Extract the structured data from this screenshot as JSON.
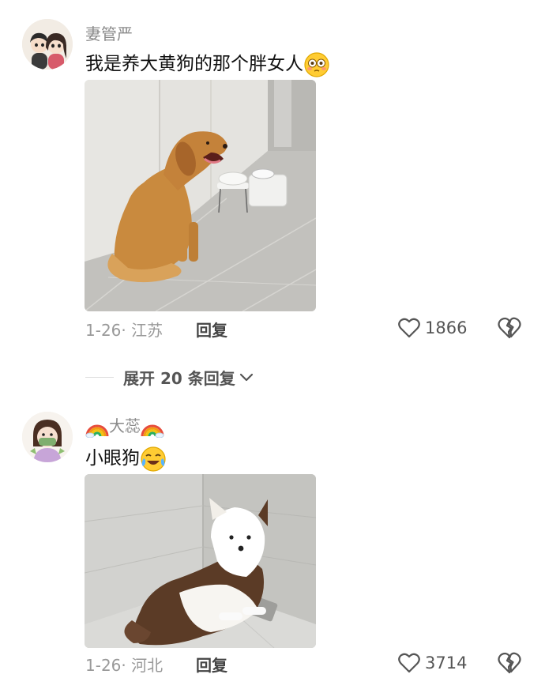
{
  "comments": [
    {
      "username": "妻管严",
      "text": "我是养大黄狗的那个胖女人",
      "text_emoji": "flushed-face-emoji",
      "photo_alt": "golden retriever sitting in kitchen",
      "date": "1-26· 江苏",
      "reply": "回复",
      "likes": "1866"
    },
    {
      "username": "大蕊",
      "username_emoji": "rainbow-emoji",
      "text": "小眼狗",
      "text_emoji": "crying-laughing-face-emoji",
      "photo_alt": "white and brown dog lying in bathroom corner",
      "date": "1-26· 河北",
      "reply": "回复",
      "likes": "3714"
    }
  ],
  "expand_replies": "展开 20 条回复",
  "colors": {
    "meta": "#999999",
    "username": "#8a8a8a",
    "text": "#111111"
  }
}
